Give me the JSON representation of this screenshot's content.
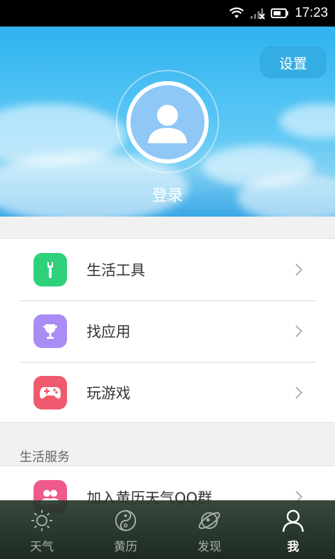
{
  "status_bar": {
    "time": "17:23"
  },
  "header": {
    "settings_label": "设置",
    "login_label": "登录",
    "avatar_icon": "user-silhouette-icon"
  },
  "menu": {
    "items": [
      {
        "label": "生活工具",
        "icon": "wrench-icon",
        "color": "#2fd07a"
      },
      {
        "label": "找应用",
        "icon": "trophy-icon",
        "color": "#a98cf4"
      },
      {
        "label": "玩游戏",
        "icon": "gamepad-icon",
        "color": "#f05a6e"
      }
    ]
  },
  "services": {
    "title": "生活服务",
    "items": [
      {
        "label": "加入黄历天气QQ群",
        "icon": "group-icon",
        "color": "#ee5b8b"
      }
    ]
  },
  "bottom_nav": {
    "items": [
      {
        "label": "天气",
        "icon": "sun-icon"
      },
      {
        "label": "黄历",
        "icon": "yin-yang-icon"
      },
      {
        "label": "发现",
        "icon": "planet-icon"
      },
      {
        "label": "我",
        "icon": "person-icon",
        "active": true
      }
    ]
  }
}
